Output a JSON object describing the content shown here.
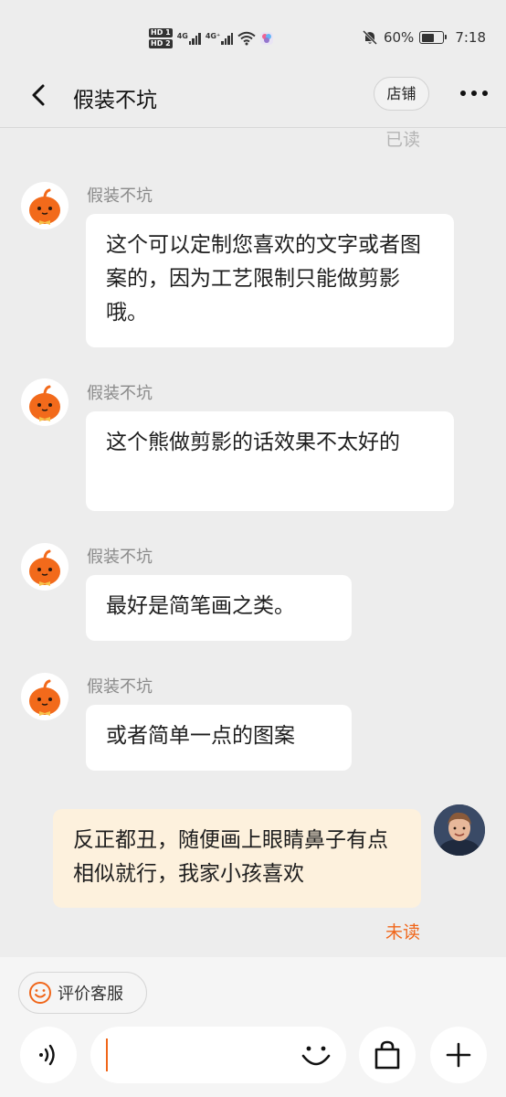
{
  "status_bar": {
    "hd1": "HD 1",
    "hd2": "HD 2",
    "net1": "4G",
    "net2": "4G⁺",
    "battery_percent": "60%",
    "time": "7:18",
    "battery_level": 0.6
  },
  "header": {
    "title": "假装不坑",
    "shop_label": "店铺"
  },
  "read_status": "已读",
  "messages": [
    {
      "sender": "假装不坑",
      "text": "这个可以定制您喜欢的文字或者图案的，因为工艺限制只能做剪影哦。"
    },
    {
      "sender": "假装不坑",
      "text": "这个熊做剪影的话效果不太好的"
    },
    {
      "sender": "假装不坑",
      "text": "最好是简笔画之类。"
    },
    {
      "sender": "假装不坑",
      "text": "或者简单一点的图案"
    }
  ],
  "outgoing": {
    "text": "反正都丑，随便画上眼睛鼻子有点相似就行，我家小孩喜欢",
    "status": "未读"
  },
  "bottom": {
    "rate_label": "评价客服"
  },
  "colors": {
    "accent": "#f0661a",
    "outgoing_bubble": "#fdf1dd",
    "background": "#ededed"
  }
}
